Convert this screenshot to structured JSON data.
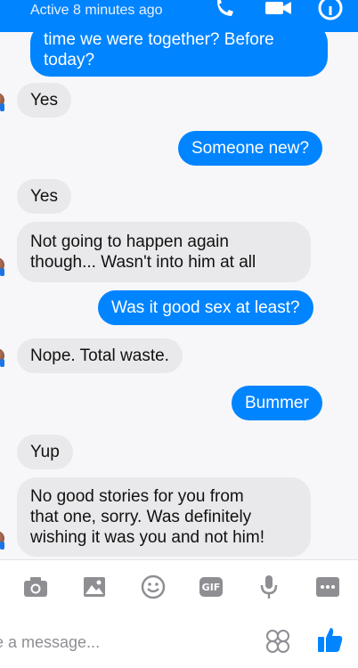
{
  "header": {
    "status": "Active 8 minutes ago"
  },
  "messages": [
    {
      "side": "out",
      "text": "time we were together? Before\ntoday?"
    },
    {
      "side": "in",
      "text": "Yes"
    },
    {
      "side": "out",
      "text": "Someone new?"
    },
    {
      "side": "in",
      "text": "Yes"
    },
    {
      "side": "in",
      "text": "Not going to happen again\nthough... Wasn't into him at all"
    },
    {
      "side": "out",
      "text": "Was it good sex at least?"
    },
    {
      "side": "in",
      "text": "Nope. Total waste."
    },
    {
      "side": "out",
      "text": "Bummer"
    },
    {
      "side": "in",
      "text": "Yup"
    },
    {
      "side": "in",
      "text": "No good stories for you from\nthat one, sorry. Was definitely\nwishing it was you and not him!"
    }
  ],
  "toolbar": {
    "gif_label": "GIF"
  },
  "composer": {
    "placeholder": "e a message..."
  },
  "colors": {
    "accent": "#0084ff",
    "incoming_bubble": "#e9e9eb",
    "icon_gray": "#8e8e93"
  }
}
